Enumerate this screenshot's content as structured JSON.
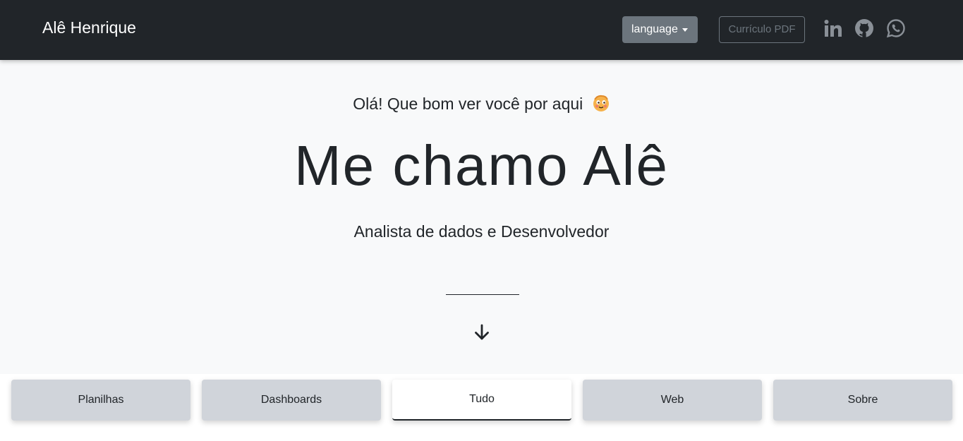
{
  "navbar": {
    "brand": "Alê Henrique",
    "language_label": "language",
    "cv_label": "Currículo PDF",
    "social_icons": [
      "linkedin-icon",
      "github-icon",
      "whatsapp-icon"
    ]
  },
  "hero": {
    "greeting": "Olá! Que bom ver você por aqui",
    "greeting_emoji": "smiling-face-emoji",
    "title": "Me chamo Alê",
    "subtitle": "Analista de dados e Desenvolvedor",
    "scroll_icon": "arrow-down-icon"
  },
  "tabs": [
    {
      "label": "Planilhas",
      "active": false
    },
    {
      "label": "Dashboards",
      "active": false
    },
    {
      "label": "Tudo",
      "active": true
    },
    {
      "label": "Web",
      "active": false
    },
    {
      "label": "Sobre",
      "active": false
    }
  ],
  "colors": {
    "navbar_bg": "#212529",
    "hero_bg": "#f8f9fa",
    "language_button_bg": "#6c757d",
    "tab_bg": "#d0d4da",
    "tab_active_bg": "#ffffff",
    "icon_gray": "#8a9097"
  }
}
